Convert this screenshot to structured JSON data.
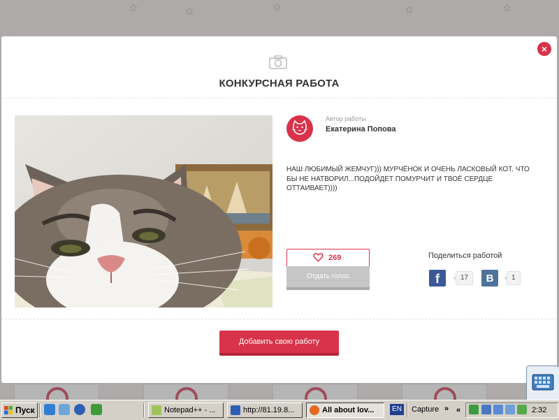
{
  "modal": {
    "title": "КОНКУРСНАЯ РАБОТА",
    "close_label": "×",
    "author": {
      "caption": "Автор работы",
      "name": "Екатерина Попова"
    },
    "description": "НАШ ЛЮБИМЫЙ ЖЕМЧУГ))) МУРЧЁНОК И ОЧЕНЬ ЛАСКОВЫЙ КОТ. ЧТО БЫ НЕ НАТВОРИЛ...ПОДОЙДЕТ ПОМУРЧИТ И ТВОЁ СЕРДЦЕ ОТТАИВАЕТ))))",
    "likes": "269",
    "vote_label": "Отдать голос",
    "share": {
      "label": "Поделиться работой",
      "facebook_glyph": "f",
      "facebook_count": "17",
      "vk_glyph": "B",
      "vk_count": "1"
    },
    "add_button_label": "Добавить свою работу"
  },
  "taskbar": {
    "start_label": "Пуск",
    "tasks": [
      {
        "label": "Notepad++ - ...",
        "active": false
      },
      {
        "label": "http://81.19.8...",
        "active": false
      },
      {
        "label": "All about lov...",
        "active": true
      }
    ],
    "language": "EN",
    "toolbar_label": "Capture",
    "toolbar_expand": "»",
    "tray_collapse": "«",
    "clock": "2:32"
  },
  "colors": {
    "accent": "#d8334a",
    "facebook": "#3b5998",
    "vk": "#4e729a",
    "vote_disabled": "#c6c6c6"
  },
  "icons": {
    "header": "camera-icon",
    "like": "heart-icon",
    "author": "cat-face-icon",
    "close": "close-icon"
  }
}
